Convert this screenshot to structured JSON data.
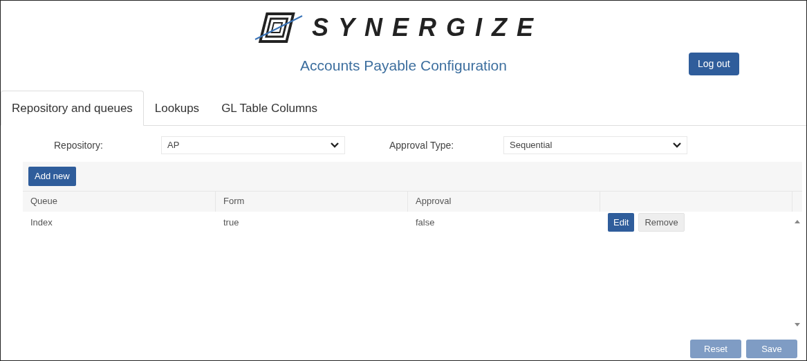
{
  "header": {
    "brand": "SYNERGIZE",
    "title": "Accounts Payable Configuration",
    "logout": "Log out"
  },
  "tabs": [
    {
      "label": "Repository and queues",
      "selected": true
    },
    {
      "label": "Lookups",
      "selected": false
    },
    {
      "label": "GL Table Columns",
      "selected": false
    }
  ],
  "filters": [
    {
      "label": "Repository:",
      "value": "AP"
    },
    {
      "label": "Approval Type:",
      "value": "Sequential"
    }
  ],
  "add_button": "Add new",
  "table": {
    "columns": [
      "Queue",
      "Form",
      "Approval"
    ],
    "rows": [
      {
        "cells": [
          "Index",
          "true",
          "false"
        ],
        "actions": [
          "Edit",
          "Remove"
        ]
      }
    ]
  },
  "footer_buttons": [
    {
      "label": "Reset",
      "disabled": true
    },
    {
      "label": "Save",
      "disabled": true
    }
  ]
}
